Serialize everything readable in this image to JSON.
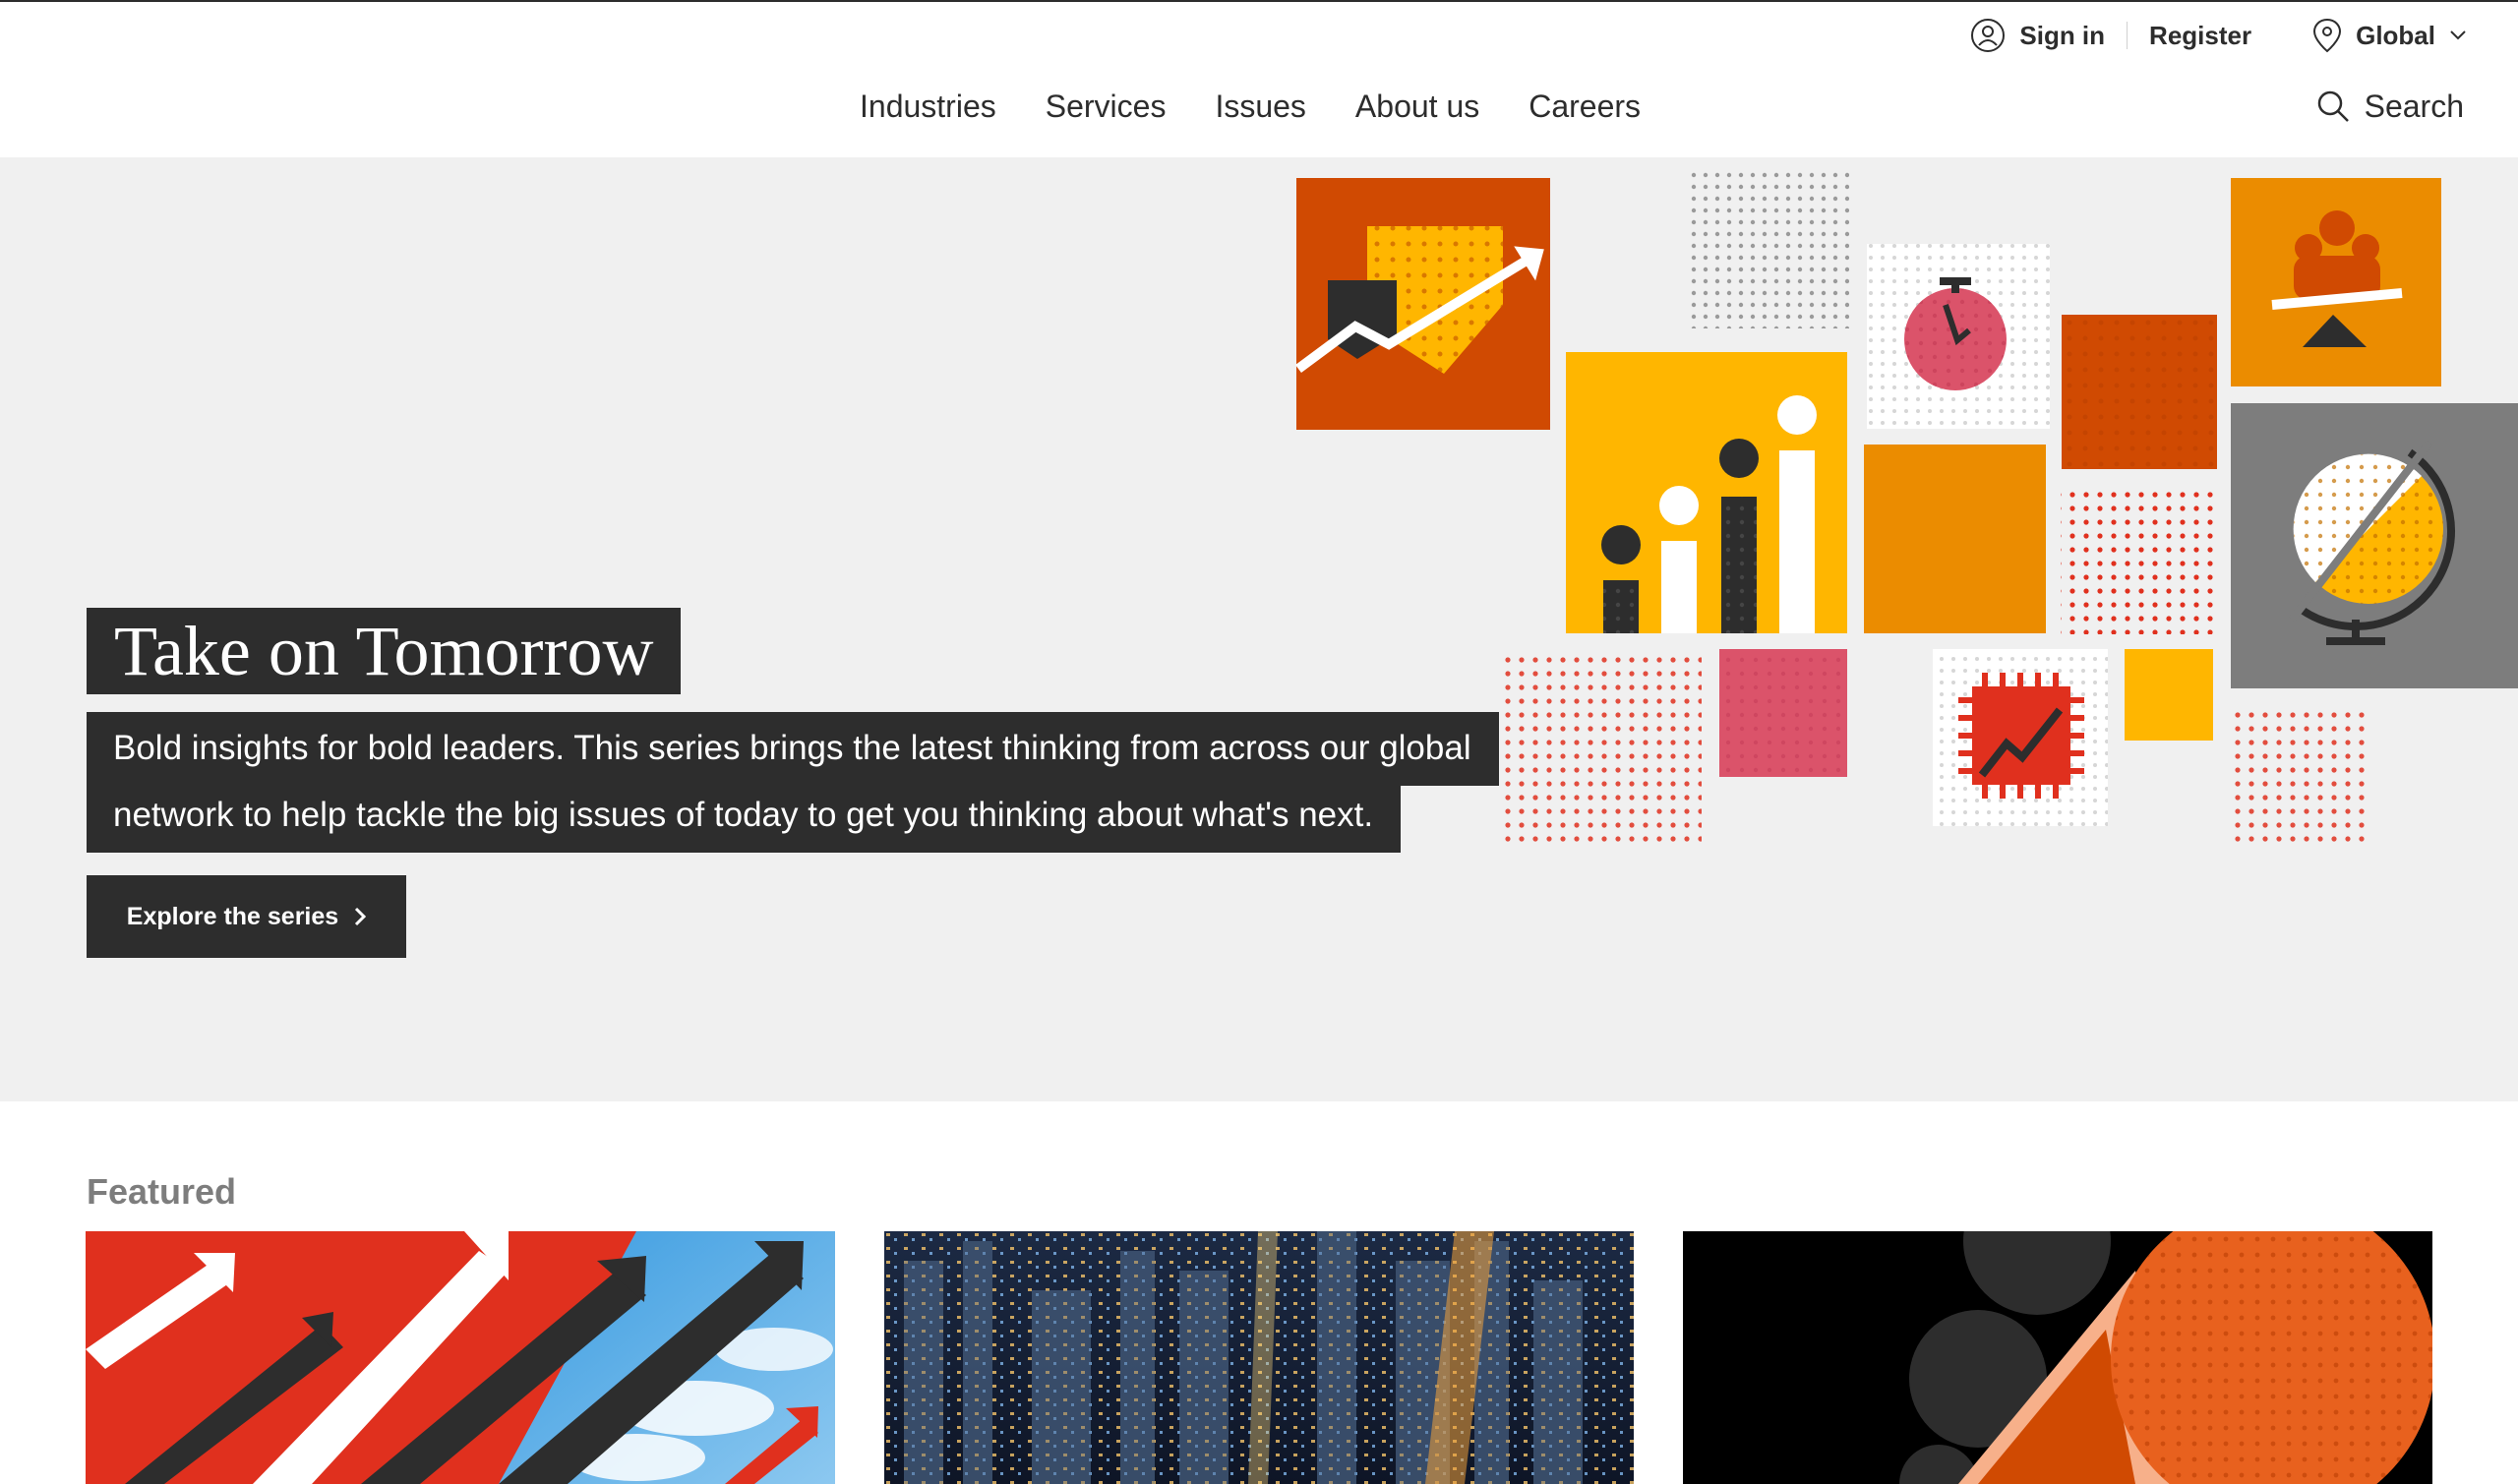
{
  "utility_bar": {
    "sign_in": "Sign in",
    "register": "Register",
    "region": "Global"
  },
  "nav": {
    "items": [
      "Industries",
      "Services",
      "Issues",
      "About us",
      "Careers"
    ],
    "search": "Search"
  },
  "hero": {
    "title": "Take on Tomorrow",
    "description": "Bold insights for bold leaders. This series brings the latest thinking from across our global network to help tackle the big issues of today to get you thinking about what's next.",
    "cta": "Explore the series"
  },
  "featured": {
    "title": "Featured",
    "cards": [
      {
        "image": "red-arrows-sky-image"
      },
      {
        "image": "city-night-aerial-image"
      },
      {
        "image": "orange-circles-abstract-image"
      }
    ]
  },
  "colors": {
    "dark": "#2d2d2d",
    "hero_bg": "#f0f0f0",
    "orange": "#d04a02",
    "amber": "#eb8c00",
    "yellow": "#ffb600",
    "red": "#e0301e",
    "pink": "#db536a",
    "grey_tile": "#7d7d7d"
  }
}
